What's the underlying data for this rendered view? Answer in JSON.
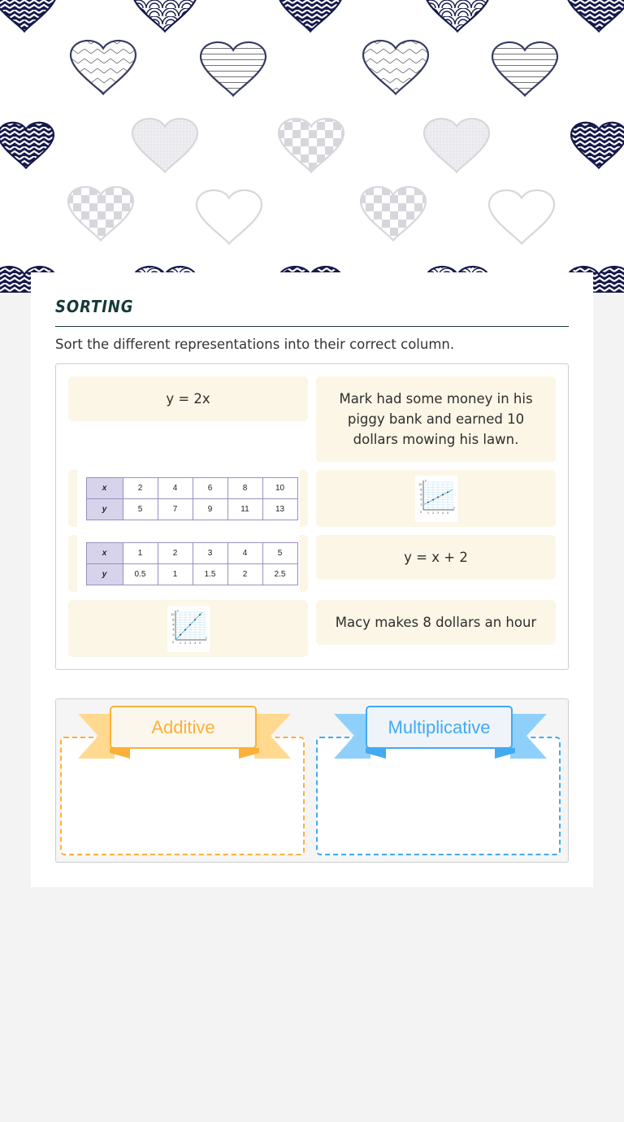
{
  "banner": {
    "description": "decorative patterned hearts",
    "colors": {
      "navy": "#16194a",
      "light": "#d6d6dc"
    }
  },
  "activity": {
    "title": "SORTING",
    "instructions": "Sort the different representations into their correct column."
  },
  "cards": [
    {
      "type": "text",
      "text": "y = 2x"
    },
    {
      "type": "text",
      "text": "Mark had some money in his piggy bank and earned 10 dollars mowing his lawn."
    },
    {
      "type": "table",
      "x_label": "x",
      "y_label": "y",
      "x": [
        "2",
        "4",
        "6",
        "8",
        "10"
      ],
      "y": [
        "5",
        "7",
        "9",
        "11",
        "13"
      ]
    },
    {
      "type": "graph",
      "name": "graph-additive",
      "points": [
        [
          1,
          3
        ],
        [
          2,
          4
        ],
        [
          3,
          5
        ],
        [
          4,
          6
        ],
        [
          5,
          7
        ]
      ],
      "x_ticks": [
        "1",
        "2",
        "3",
        "4",
        "5"
      ],
      "y_ticks": [
        "2",
        "4",
        "6",
        "8",
        "10"
      ],
      "y_axis": "y",
      "x_axis": "x",
      "origin": "0"
    },
    {
      "type": "table",
      "x_label": "x",
      "y_label": "y",
      "x": [
        "1",
        "2",
        "3",
        "4",
        "5"
      ],
      "y": [
        "0.5",
        "1",
        "1.5",
        "2",
        "2.5"
      ]
    },
    {
      "type": "text",
      "text": "y = x + 2"
    },
    {
      "type": "graph",
      "name": "graph-multiplicative",
      "points": [
        [
          1,
          2
        ],
        [
          2,
          4
        ],
        [
          3,
          6
        ],
        [
          4,
          8
        ],
        [
          5,
          10
        ]
      ],
      "x_ticks": [
        "1",
        "2",
        "3",
        "4",
        "5"
      ],
      "y_ticks": [
        "2",
        "4",
        "6",
        "8",
        "10"
      ],
      "y_axis": "y",
      "x_axis": "x",
      "origin": "0"
    },
    {
      "type": "text",
      "text": "Macy makes 8 dollars an hour"
    }
  ],
  "bins": [
    {
      "label": "Additive",
      "color": "#fbb03b",
      "ribbon_color": "#ffd98f",
      "label_bg": "#fcf7ec"
    },
    {
      "label": "Multiplicative",
      "color": "#42aaf1",
      "ribbon_color": "#8fd0fb",
      "label_bg": "#eef4f9"
    }
  ],
  "colors": {
    "tile_bg": "#fbf6e6",
    "title": "#17393a"
  }
}
